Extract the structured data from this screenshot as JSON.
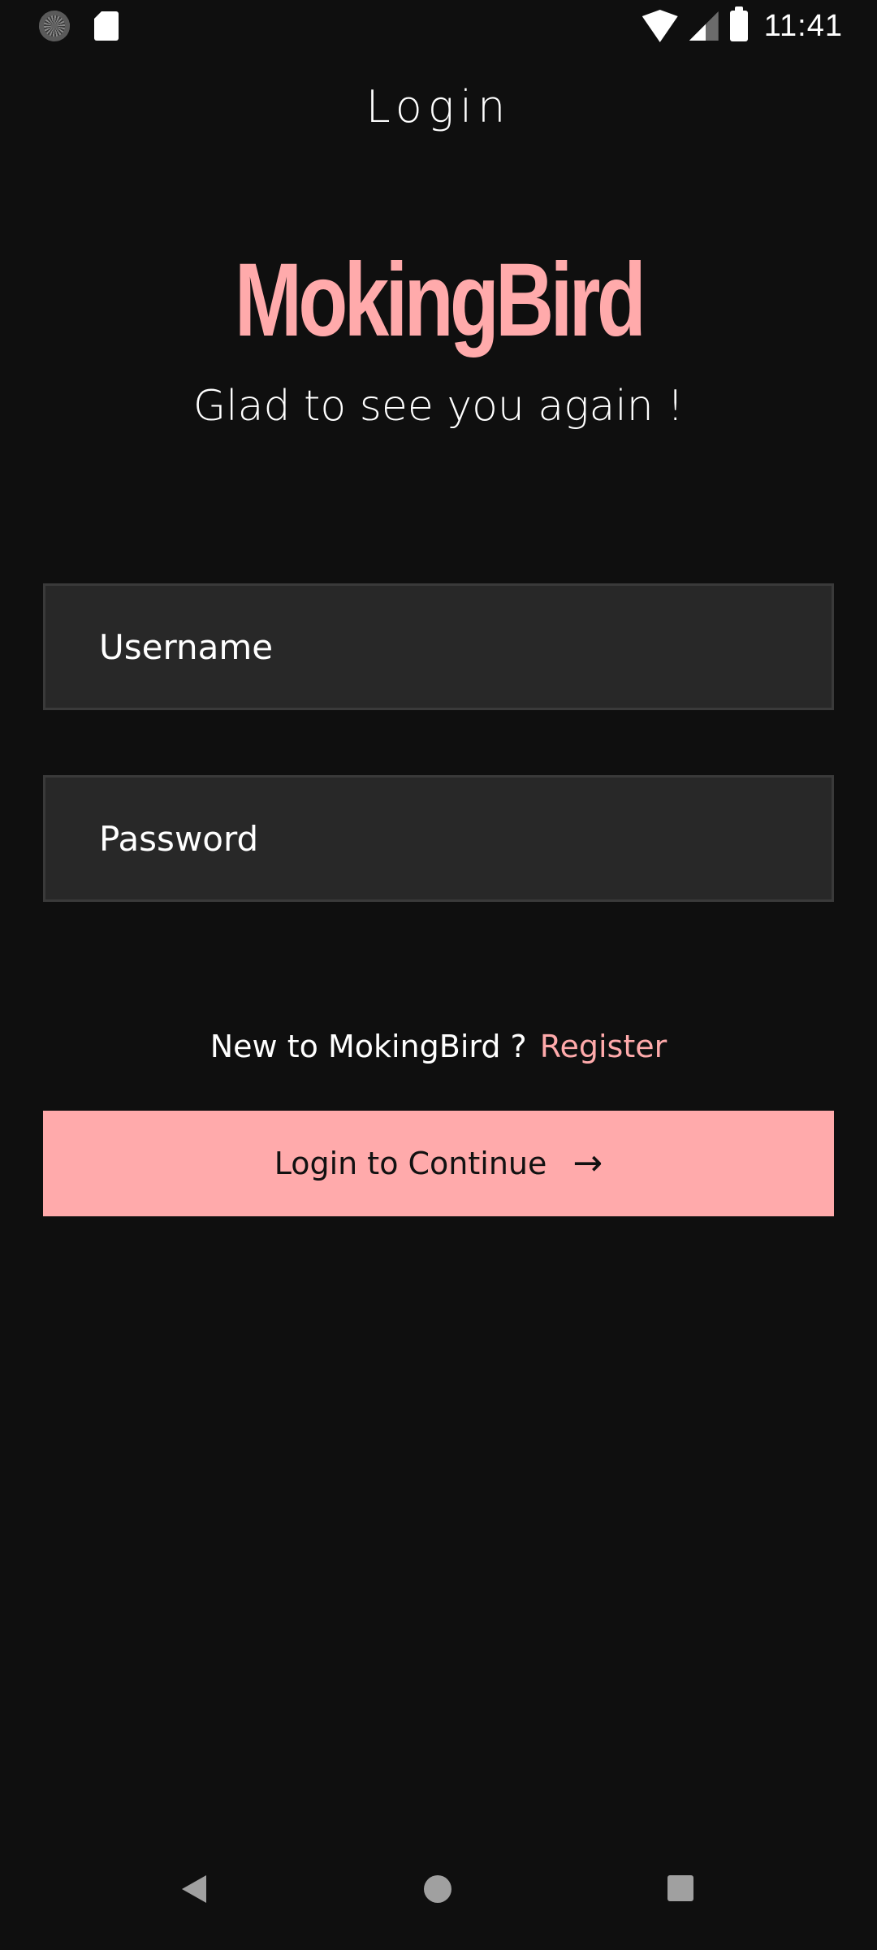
{
  "status_bar": {
    "time": "11:41",
    "icons": [
      "loading-icon",
      "sd-card-icon",
      "wifi-icon",
      "cell-signal-icon",
      "battery-icon"
    ]
  },
  "header": {
    "title": "Login"
  },
  "brand": {
    "logo_text": "MokingBird",
    "tagline": "Glad to see you again !",
    "accent_color": "#ffaaab",
    "background_color": "#0f0f0f"
  },
  "form": {
    "username_placeholder": "Username",
    "username_value": "",
    "password_placeholder": "Password",
    "password_value": ""
  },
  "register": {
    "prompt": "New to MokingBird ?",
    "link_label": "Register"
  },
  "actions": {
    "login_label": "Login to Continue",
    "login_icon": "arrow-right-icon"
  },
  "nav_bar": {
    "buttons": [
      "back-icon",
      "home-icon",
      "recents-icon"
    ]
  }
}
